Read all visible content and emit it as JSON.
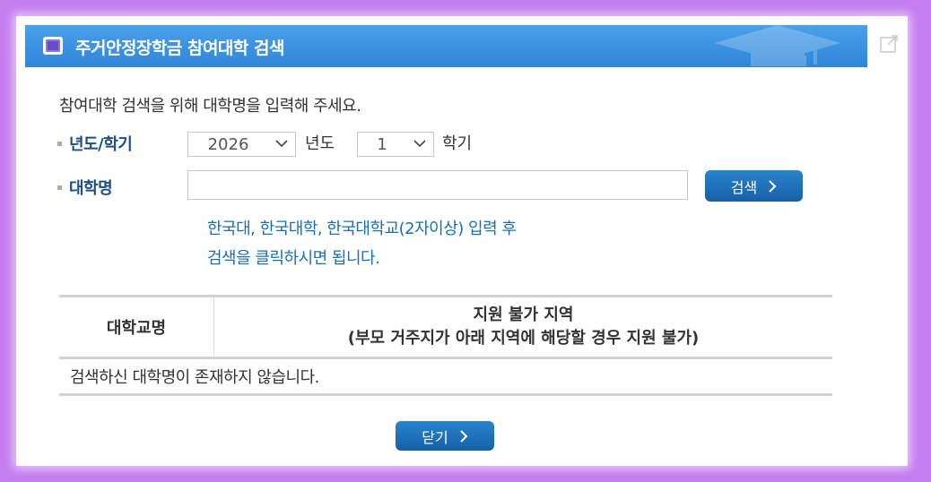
{
  "dialog": {
    "title": "주거안정장학금 참여대학 검색",
    "intro": "참여대학 검색을 위해 대학명을 입력해 주세요.",
    "year_label": "년도/학기",
    "year_value": "2026",
    "year_suffix": "년도",
    "term_value": "1",
    "term_suffix": "학기",
    "univ_label": "대학명",
    "univ_input_value": "",
    "search_button": "검색",
    "hint_line1": "한국대, 한국대학, 한국대학교(2자이상) 입력 후",
    "hint_line2": "검색을 클릭하시면 됩니다.",
    "close_button": "닫기"
  },
  "table": {
    "col1_header": "대학교명",
    "col2_header_line1": "지원 불가 지역",
    "col2_header_line2": "(부모 거주지가 아래 지역에 해당할 경우 지원 불가)",
    "empty_message": "검색하신 대학명이 존재하지 않습니다."
  },
  "icons": {
    "title_icon": "window-icon",
    "corner_icon": "external-link-icon",
    "dropdown_icon": "chevron-down-icon",
    "button_arrow": "chevron-right-icon"
  },
  "colors": {
    "background": "#c57df0",
    "title_bar": "#3b93e2",
    "label": "#1c4f86",
    "hint": "#1a6fb0",
    "button": "#1c6db5"
  }
}
